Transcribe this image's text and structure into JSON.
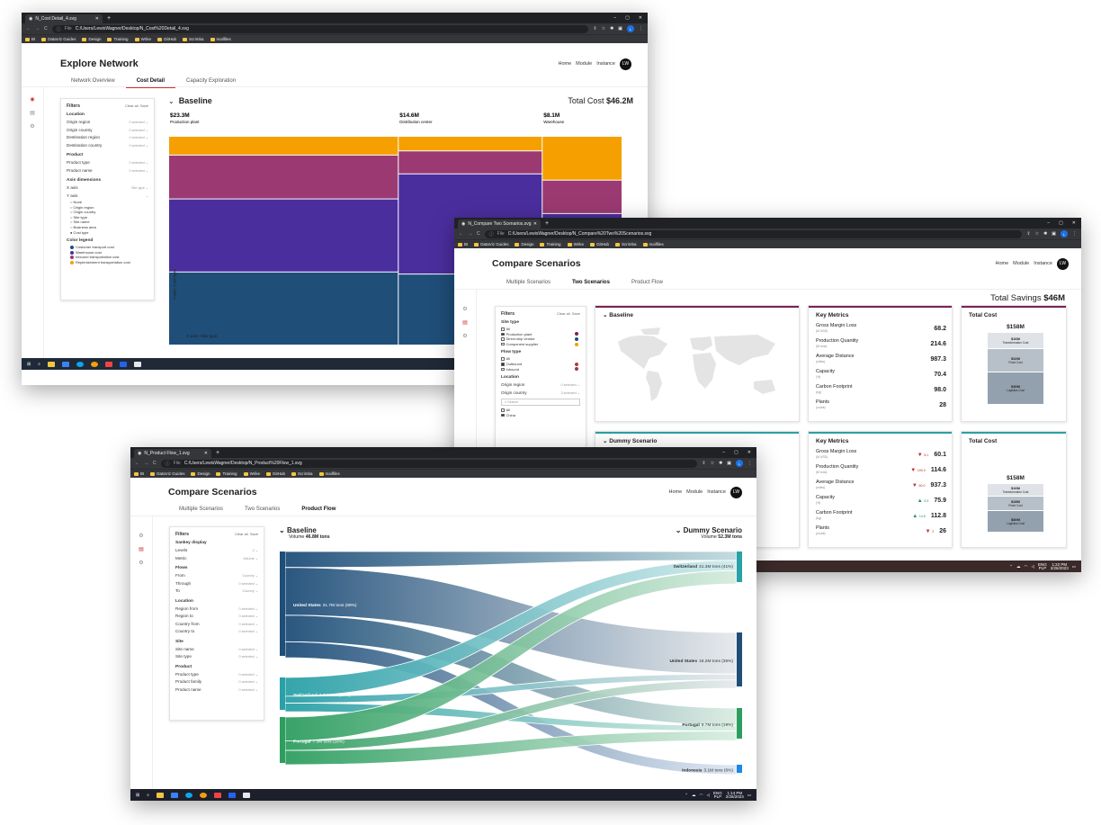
{
  "win1": {
    "tab_title": "N_Cost Detail_4.svg",
    "url_prefix": "File",
    "url": "C:/Users/LewisWagner/Desktop/N_Cost%20Detail_4.svg",
    "bookmarks": [
      "BI",
      "DataViz Guides",
      "Design",
      "Training",
      "Wrike",
      "GitHub",
      "Scrimba",
      "mailfiles"
    ],
    "app_title": "Explore Network",
    "nav": [
      "Home",
      "Module",
      "Instance"
    ],
    "avatar": "LW",
    "subtabs": [
      "Network Overview",
      "Cost Detail",
      "Capacity Exploration"
    ],
    "filters": {
      "title": "Filters",
      "clear": "Clear all",
      "save": "Save",
      "location": "Location",
      "location_rows": [
        [
          "Origin region",
          "0 selected"
        ],
        [
          "Origin country",
          "0 selected"
        ],
        [
          "Destination region",
          "0 selected"
        ],
        [
          "Destination country",
          "0 selected"
        ]
      ],
      "product": "Product",
      "product_rows": [
        [
          "Product type",
          "0 selected"
        ],
        [
          "Product name",
          "0 selected"
        ]
      ],
      "axis": "Axis dimensions",
      "axis_rows": [
        [
          "X axis",
          "Site type"
        ],
        [
          "Y axis",
          ""
        ]
      ],
      "y_options": [
        "None",
        "Origin region",
        "Origin country",
        "Site type",
        "Site name",
        "Business area",
        "Cost type"
      ],
      "color_legend": "Color legend",
      "legend": [
        [
          "Customer transport cost",
          "#1f4e79"
        ],
        [
          "Warehouse cost",
          "#4b2e9e"
        ],
        [
          "Inbound transportation cost",
          "#9b3a72"
        ],
        [
          "Replenishment transportation cost",
          "#f5a000"
        ]
      ]
    },
    "scenario": "Baseline",
    "total_cost_label": "Total Cost",
    "total_cost": "$46.2M",
    "chart_data": {
      "type": "bar",
      "title": "",
      "xlabel": "X-axis: Site type",
      "ylabel": "Y-axis: Cost type",
      "categories": [
        "Production plant",
        "Distribution center",
        "Warehouse"
      ],
      "category_totals": [
        "$23.3M",
        "$14.6M",
        "$8.1M"
      ],
      "category_widths": [
        23.3,
        14.6,
        8.1
      ],
      "series": [
        {
          "name": "Replenishment transportation cost",
          "color": "#f5a000",
          "values": [
            0.09,
            0.07,
            0.21
          ]
        },
        {
          "name": "Inbound transportation cost",
          "color": "#9b3a72",
          "values": [
            0.21,
            0.11,
            0.16
          ]
        },
        {
          "name": "Warehouse cost",
          "color": "#4b2e9e",
          "values": [
            0.35,
            0.48,
            0.18
          ]
        },
        {
          "name": "Customer transport cost",
          "color": "#1f4e79",
          "values": [
            0.35,
            0.34,
            0.45
          ]
        }
      ]
    }
  },
  "win2": {
    "tab_title": "N_Compare Two Scenarios.svg",
    "url_prefix": "File",
    "url": "C:/Users/LewisWagner/Desktop/N_Compare%20Two%20Scenarios.svg",
    "app_title": "Compare Scenarios",
    "nav": [
      "Home",
      "Module",
      "Instance"
    ],
    "avatar": "LW",
    "subtabs": [
      "Multiple Scenarios",
      "Two Scenarios",
      "Product Flow"
    ],
    "total_savings_label": "Total Savings",
    "total_savings": "$46M",
    "filters": {
      "title": "Filters",
      "clear": "Clear all",
      "save": "Save",
      "site_type": "Site type",
      "site_opts": [
        [
          "All",
          "",
          false
        ],
        [
          "Production plant",
          "#7b2157",
          true
        ],
        [
          "Direct ship vendor",
          "#1f4e79",
          false
        ],
        [
          "Component supplier",
          "#f5a000",
          false
        ]
      ],
      "flow_type": "Flow type",
      "flow_opts": [
        [
          "All",
          "",
          false
        ],
        [
          "Outbound",
          "#c0392b",
          true
        ],
        [
          "Inbound",
          "#8e3b5e",
          false
        ]
      ],
      "location": "Location",
      "location_rows": [
        [
          "Origin region",
          "0 selected"
        ],
        [
          "Origin country",
          "3 selected"
        ]
      ],
      "search_placeholder": "Search",
      "countries": [
        [
          "All",
          false
        ],
        [
          "China",
          true
        ]
      ]
    },
    "baseline": "Baseline",
    "dummy": "Dummy Scenario",
    "key_metrics": "Key Metrics",
    "total_cost": "Total Cost",
    "metrics_baseline": [
      [
        "Gross Margin Loss",
        "(M USD)",
        "68.2"
      ],
      [
        "Production Quantity",
        "(M tons)",
        "214.6"
      ],
      [
        "Average Distance",
        "(miles)",
        "987.3"
      ],
      [
        "Capacity",
        "(%)",
        "70.4"
      ],
      [
        "Carbon Footprint",
        "(kg)",
        "98.0"
      ],
      [
        "Plants",
        "(count)",
        "28"
      ]
    ],
    "metrics_dummy": [
      [
        "Gross Margin Loss",
        "(M USD)",
        "60.1",
        "8.1",
        "dn"
      ],
      [
        "Production Quantity",
        "(M tons)",
        "114.6",
        "100.0",
        "dn"
      ],
      [
        "Average Distance",
        "(miles)",
        "937.3",
        "50.0",
        "dn"
      ],
      [
        "Capacity",
        "(%)",
        "75.9",
        "5.5",
        "up"
      ],
      [
        "Carbon Footprint",
        "(kg)",
        "112.8",
        "14.8",
        "up"
      ],
      [
        "Plants",
        "(count)",
        "26",
        "2",
        "dn"
      ]
    ],
    "cost_baseline": {
      "total": "$158M",
      "parts": [
        [
          "$16M",
          "Transformation Cost"
        ],
        [
          "$32M",
          "Fixed Cost"
        ],
        [
          "$30M",
          "Logistics Cost"
        ]
      ]
    },
    "cost_dummy": {
      "total": "$158M",
      "parts": [
        [
          "$16M",
          "Transformation Cost"
        ],
        [
          "$28M",
          "Fixed Cost"
        ],
        [
          "$80M",
          "Logistics Cost"
        ]
      ]
    },
    "clock": [
      "1:22 PM",
      "2/26/2023"
    ],
    "lang": [
      "ENG",
      "PLP"
    ]
  },
  "win3": {
    "tab_title": "N_Product Flow_1.svg",
    "url_prefix": "File",
    "url": "C:/Users/LewisWagner/Desktop/N_Product%20Flow_1.svg",
    "app_title": "Compare Scenarios",
    "nav": [
      "Home",
      "Module",
      "Instance"
    ],
    "avatar": "LW",
    "subtabs": [
      "Multiple Scenarios",
      "Two Scenarios",
      "Product Flow"
    ],
    "filters": {
      "title": "Filters",
      "clear": "Clear all",
      "save": "Save",
      "groups": [
        {
          "name": "Sankey display",
          "rows": [
            [
              "Levels",
              "2"
            ],
            [
              "Metric",
              "Volume"
            ]
          ]
        },
        {
          "name": "Flows",
          "rows": [
            [
              "From",
              "Country"
            ],
            [
              "Through",
              "0 selected"
            ],
            [
              "To",
              "Country"
            ]
          ]
        },
        {
          "name": "Location",
          "rows": [
            [
              "Region from",
              "0 selected"
            ],
            [
              "Region to",
              "0 selected"
            ],
            [
              "Country from",
              "0 selected"
            ],
            [
              "Country to",
              "0 selected"
            ]
          ]
        },
        {
          "name": "Site",
          "rows": [
            [
              "Site name",
              "0 selected"
            ],
            [
              "Site type",
              "0 selected"
            ]
          ]
        },
        {
          "name": "Product",
          "rows": [
            [
              "Product type",
              "0 selected"
            ],
            [
              "Product family",
              "0 selected"
            ],
            [
              "Product name",
              "0 selected"
            ]
          ]
        }
      ]
    },
    "left_title": "Baseline",
    "left_volume_label": "Volume",
    "left_volume": "46.8M tons",
    "right_title": "Dummy Scenario",
    "right_volume_label": "Volume",
    "right_volume": "52.3M tons",
    "left_nodes": [
      {
        "name": "United States",
        "value": "31.7M tons (68%)",
        "color": "#1f4e79"
      },
      {
        "name": "Switzerland",
        "value": "7.8M tons (17%)",
        "color": "#2aa0a7"
      },
      {
        "name": "Portugal",
        "value": "7.3M tons (16%)",
        "color": "#2e9e60"
      }
    ],
    "right_nodes": [
      {
        "name": "Switzerland",
        "value": "21.3M tons (41%)",
        "color": "#2aa0a7"
      },
      {
        "name": "United States",
        "value": "18.2M tons (35%)",
        "color": "#1f4e79"
      },
      {
        "name": "Portugal",
        "value": "9.7M tons (19%)",
        "color": "#2e9e60"
      },
      {
        "name": "Indonesia",
        "value": "3.1M tons (6%)",
        "color": "#1e88e5"
      }
    ],
    "clock": [
      "1:14 PM",
      "2/26/2023"
    ],
    "lang": [
      "ENG",
      "PLP"
    ]
  }
}
